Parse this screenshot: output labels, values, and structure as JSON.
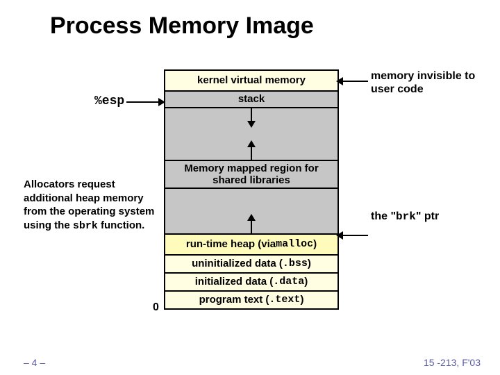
{
  "title": "Process Memory Image",
  "segments": {
    "kernel": "kernel virtual memory",
    "stack": "stack",
    "mmap": "Memory mapped region for shared libraries",
    "heap_prefix": "run-time heap (via ",
    "heap_code": "malloc",
    "heap_suffix": ")",
    "ubss_prefix": "uninitialized data (",
    "ubss_code": ".bss",
    "ubss_suffix": ")",
    "idata_prefix": "initialized data (",
    "idata_code": ".data",
    "idata_suffix": ")",
    "ptext_prefix": "program text (",
    "ptext_code": ".text",
    "ptext_suffix": ")"
  },
  "labels": {
    "esp": "%esp",
    "mem_invisible": "memory invisible to user code",
    "brk_prefix": "the \"",
    "brk_code": "brk",
    "brk_suffix": "\" ptr",
    "zero": "0"
  },
  "alloc_note": {
    "line1": "Allocators request additional heap memory from the operating system using the ",
    "code": "sbrk",
    "line2": " function."
  },
  "footer": {
    "page": "– 4 –",
    "course": "15 -213, F'03"
  }
}
